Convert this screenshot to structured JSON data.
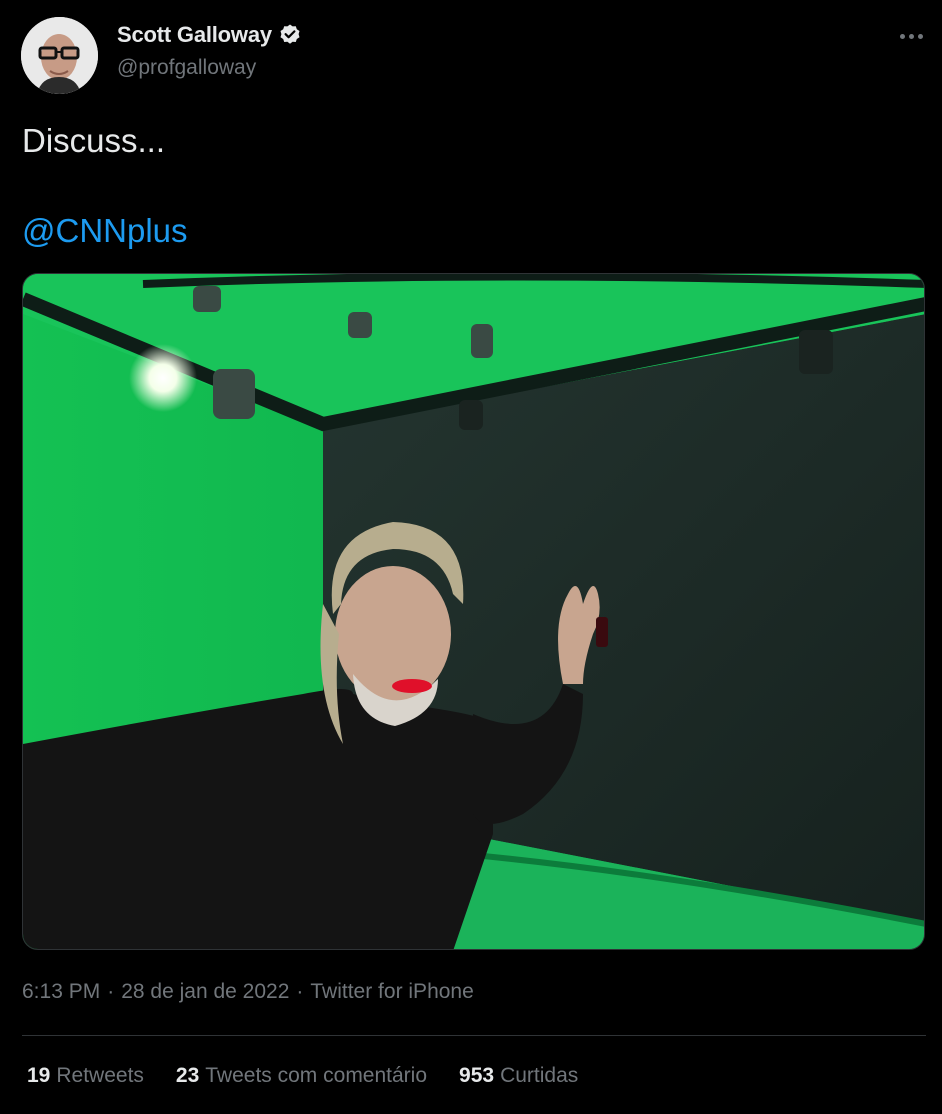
{
  "author": {
    "display_name": "Scott Galloway",
    "handle": "@profgalloway",
    "verified_icon": "verified-badge-icon",
    "avatar_icon": "avatar"
  },
  "tweet": {
    "text": "Discuss...",
    "mention": "@CNNplus",
    "media_icon": "photo",
    "time": "6:13 PM",
    "separator1": "·",
    "date": "28 de jan de 2022",
    "separator2": "·",
    "source": "Twitter for iPhone"
  },
  "stats": [
    {
      "count": "19",
      "label": "Retweets"
    },
    {
      "count": "23",
      "label": "Tweets com comentário"
    },
    {
      "count": "953",
      "label": "Curtidas"
    }
  ],
  "colors": {
    "background": "#000000",
    "text": "#e7e9ea",
    "secondary": "#71767b",
    "link": "#1d9bf0",
    "divider": "#2f3336"
  }
}
